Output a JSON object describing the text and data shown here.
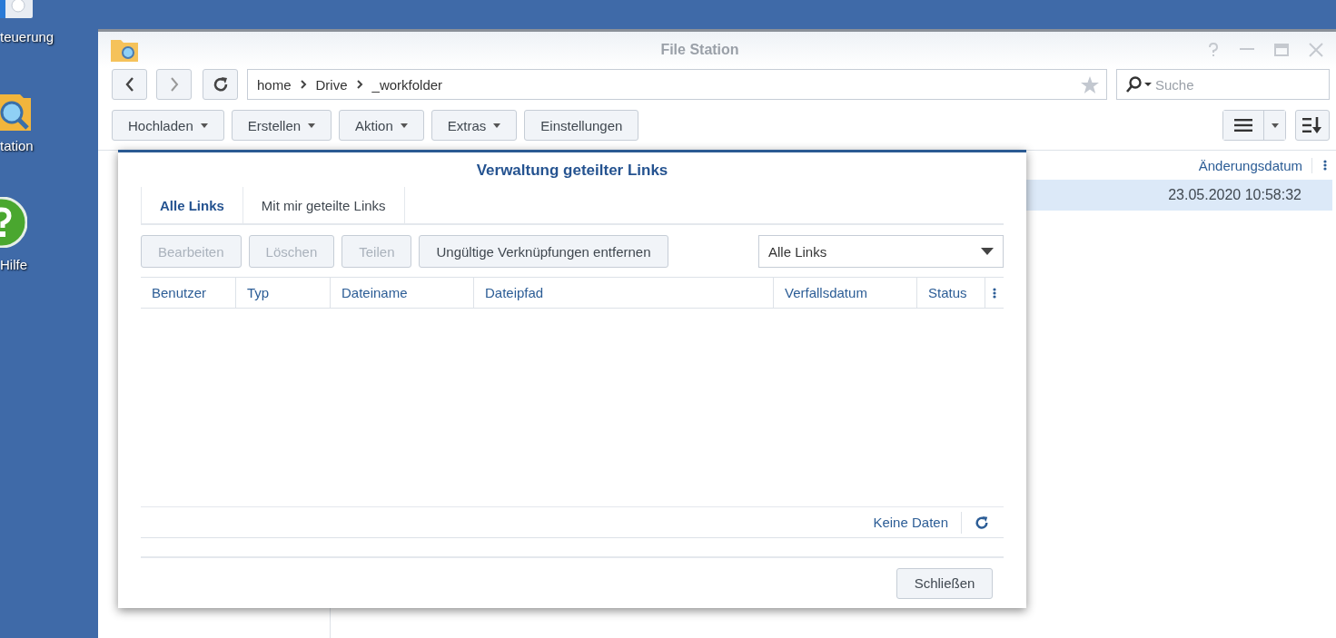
{
  "desktop_icons": [
    {
      "kind": "control",
      "label": "teuerung"
    },
    {
      "kind": "folder",
      "label": "tation"
    },
    {
      "kind": "help",
      "label": "Hilfe"
    }
  ],
  "window": {
    "title": "File Station",
    "path": [
      "home",
      "Drive",
      "_workfolder"
    ],
    "search": {
      "placeholder": "Suche"
    },
    "toolbar": [
      {
        "label": "Hochladen",
        "dropdown": true
      },
      {
        "label": "Erstellen",
        "dropdown": true
      },
      {
        "label": "Aktion",
        "dropdown": true
      },
      {
        "label": "Extras",
        "dropdown": true
      },
      {
        "label": "Einstellungen",
        "dropdown": false
      }
    ],
    "file_list": {
      "column": "Änderungsdatum",
      "rows": [
        {
          "date": "23.05.2020 10:58:32",
          "selected": true
        }
      ]
    }
  },
  "dialog": {
    "title": "Verwaltung geteilter Links",
    "tabs": [
      {
        "label": "Alle Links",
        "selected": true
      },
      {
        "label": "Mit mir geteilte Links",
        "selected": false
      }
    ],
    "actions": [
      {
        "label": "Bearbeiten",
        "disabled": true
      },
      {
        "label": "Löschen",
        "disabled": true
      },
      {
        "label": "Teilen",
        "disabled": true
      },
      {
        "label": "Ungültige Verknüpfungen entfernen",
        "disabled": false
      }
    ],
    "filter": "Alle Links",
    "columns": [
      "Benutzer",
      "Typ",
      "Dateiname",
      "Dateipfad",
      "Verfallsdatum",
      "Status"
    ],
    "status": "Keine Daten",
    "close_button": "Schließen"
  }
}
